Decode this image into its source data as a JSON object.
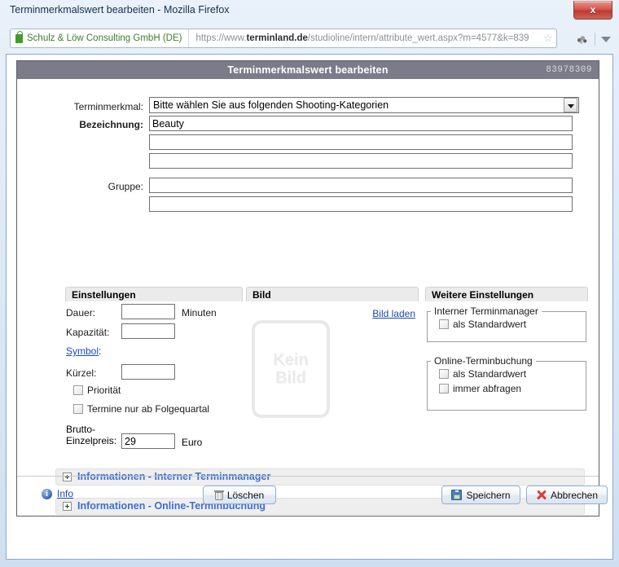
{
  "window": {
    "title": "Terminmerkmalswert bearbeiten - Mozilla Firefox",
    "close_label": "x"
  },
  "browser": {
    "identity": "Schulz & Löw Consulting GmbH (DE)",
    "url_prefix": "https://www.",
    "url_domain": "terminland.de",
    "url_path": "/studioline/intern/attribute_wert.aspx?m=4577&k=839",
    "star_icon": "☆",
    "lock_icon": "lock-icon",
    "extension_icon": "extension-icon",
    "dropdown_icon": "chevron-down-icon"
  },
  "panel": {
    "title": "Terminmerkmalswert bearbeiten",
    "id": "83978309"
  },
  "form": {
    "terminmerkmal_label": "Terminmerkmal:",
    "terminmerkmal_value": "Bitte wählen Sie aus folgenden Shooting-Kategorien",
    "bezeichnung_label": "Bezeichnung:",
    "bezeichnung_value": "Beauty",
    "bezeichnung_2": "",
    "bezeichnung_3": "",
    "gruppe_label": "Gruppe:",
    "gruppe_1": "",
    "gruppe_2": ""
  },
  "columns": {
    "einstellungen": {
      "header": "Einstellungen",
      "dauer_label": "Dauer:",
      "dauer_value": "",
      "dauer_unit": "Minuten",
      "kapazitaet_label": "Kapazität:",
      "kapazitaet_value": "",
      "symbol_label": "Symbol",
      "symbol_colon": ":",
      "kuerzel_label": "Kürzel:",
      "kuerzel_value": "",
      "prioritaet_label": "Priorität",
      "folgequartal_label": "Termine nur ab Folgequartal",
      "brutto_line1": "Brutto-",
      "brutto_line2": "Einzelpreis:",
      "brutto_value": "29",
      "brutto_unit": "Euro"
    },
    "bild": {
      "header": "Bild",
      "bild_laden_label": "Bild laden",
      "placeholder_line1": "Kein",
      "placeholder_line2": "Bild"
    },
    "weitere": {
      "header": "Weitere Einstellungen",
      "interner_legend": "Interner Terminmanager",
      "interner_standardwert": "als Standardwert",
      "online_legend": "Online-Terminbuchung",
      "online_standardwert": "als Standardwert",
      "online_immer": "immer abfragen"
    }
  },
  "accordions": [
    {
      "label": "Informationen - Interner Terminmanager"
    },
    {
      "label": "Informationen - Online-Terminbuchung"
    }
  ],
  "footer": {
    "info_label": "Info",
    "info_icon": "info-icon",
    "delete_label": "Löschen",
    "delete_icon": "trash-icon",
    "save_label": "Speichern",
    "save_icon": "floppy-disk-icon",
    "cancel_label": "Abbrechen",
    "cancel_icon": "red-x-icon"
  },
  "colors": {
    "panel_header_bg": "#7b7b8a",
    "link": "#1a49b8",
    "accordion_text": "#3f6fd1",
    "identity_text": "#3e7c2b",
    "cancel_red": "#e03a3a"
  }
}
